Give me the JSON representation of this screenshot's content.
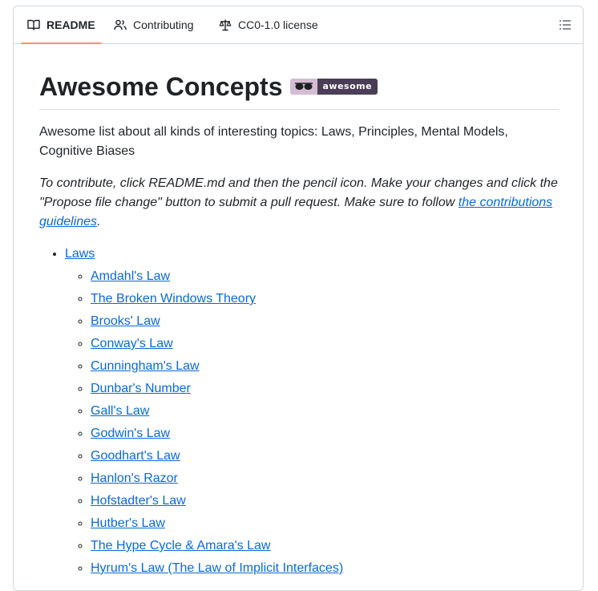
{
  "tabs": {
    "readme": "README",
    "contributing": "Contributing",
    "license": "CC0-1.0 license"
  },
  "title": "Awesome Concepts",
  "badge": {
    "text": "awesome",
    "left_color": "#d3bcd4",
    "right_color": "#4a3e56"
  },
  "intro": "Awesome list about all kinds of interesting topics: Laws, Principles, Mental Models, Cognitive Biases",
  "contribute": {
    "before": "To contribute, click README.md and then the pencil icon. Make your changes and click the \"Propose file change\" button to submit a pull request. Make sure to follow ",
    "link": "the contributions guidelines",
    "after": "."
  },
  "list": {
    "section": "Laws",
    "items": [
      "Amdahl's Law",
      "The Broken Windows Theory",
      "Brooks' Law",
      "Conway's Law",
      "Cunningham's Law",
      "Dunbar's Number",
      "Gall's Law",
      "Godwin's Law",
      "Goodhart's Law",
      "Hanlon's Razor",
      "Hofstadter's Law",
      "Hutber's Law",
      "The Hype Cycle & Amara's Law",
      "Hyrum's Law (The Law of Implicit Interfaces)"
    ]
  },
  "colors": {
    "link": "#0969da",
    "tab_underline": "#fd8c73",
    "border": "#d0d7de"
  }
}
